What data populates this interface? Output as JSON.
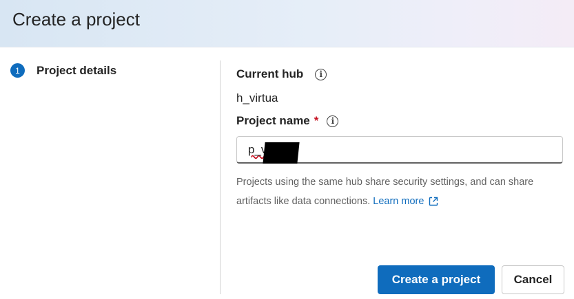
{
  "dialog": {
    "title": "Create a project"
  },
  "steps": [
    {
      "number": "1",
      "label": "Project details"
    }
  ],
  "hub": {
    "label": "Current hub",
    "value": "h_virtua"
  },
  "project_name": {
    "label": "Project name",
    "required_mark": "*",
    "value": "p_v"
  },
  "help": {
    "text": "Projects using the same hub share security settings, and can share artifacts like data connections.",
    "link_label": "Learn more"
  },
  "actions": {
    "primary_label": "Create a project",
    "cancel_label": "Cancel"
  },
  "icons": {
    "info": "info-icon",
    "external": "external-link-icon"
  },
  "colors": {
    "accent": "#0f6cbd",
    "required": "#c50f1f"
  }
}
